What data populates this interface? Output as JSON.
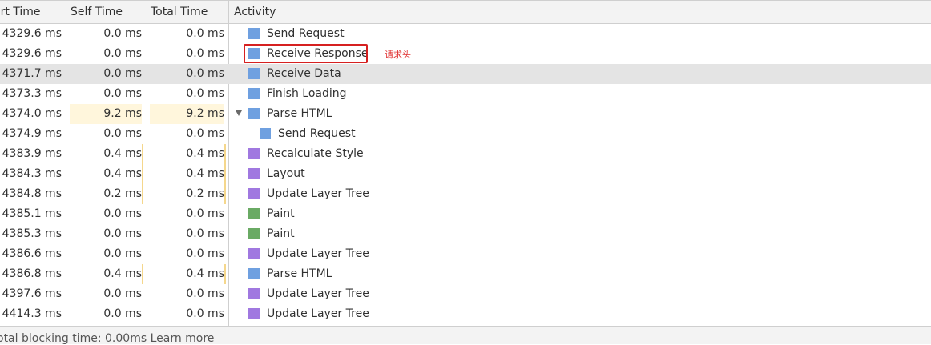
{
  "header": {
    "start_time": "art Time",
    "self_time": "Self Time",
    "total_time": "Total Time",
    "activity": "Activity"
  },
  "colors": {
    "network": "#6fa0e0",
    "rendering": "#a078e0",
    "painting": "#6aaa64",
    "annotation": "#d62020"
  },
  "rows": [
    {
      "start": "4329.6 ms",
      "self": "0.0 ms",
      "total": "0.0 ms",
      "activity": "Send Request",
      "category": "network"
    },
    {
      "start": "4329.6 ms",
      "self": "0.0 ms",
      "total": "0.0 ms",
      "activity": "Receive Response",
      "category": "network"
    },
    {
      "start": "4371.7 ms",
      "self": "0.0 ms",
      "total": "0.0 ms",
      "activity": "Receive Data",
      "category": "network"
    },
    {
      "start": "4373.3 ms",
      "self": "0.0 ms",
      "total": "0.0 ms",
      "activity": "Finish Loading",
      "category": "network"
    },
    {
      "start": "4374.0 ms",
      "self": "9.2 ms",
      "total": "9.2 ms",
      "activity": "Parse HTML",
      "category": "network"
    },
    {
      "start": "4374.9 ms",
      "self": "0.0 ms",
      "total": "0.0 ms",
      "activity": "Send Request",
      "category": "network"
    },
    {
      "start": "4383.9 ms",
      "self": "0.4 ms",
      "total": "0.4 ms",
      "activity": "Recalculate Style",
      "category": "rendering"
    },
    {
      "start": "4384.3 ms",
      "self": "0.4 ms",
      "total": "0.4 ms",
      "activity": "Layout",
      "category": "rendering"
    },
    {
      "start": "4384.8 ms",
      "self": "0.2 ms",
      "total": "0.2 ms",
      "activity": "Update Layer Tree",
      "category": "rendering"
    },
    {
      "start": "4385.1 ms",
      "self": "0.0 ms",
      "total": "0.0 ms",
      "activity": "Paint",
      "category": "painting"
    },
    {
      "start": "4385.3 ms",
      "self": "0.0 ms",
      "total": "0.0 ms",
      "activity": "Paint",
      "category": "painting"
    },
    {
      "start": "4386.6 ms",
      "self": "0.0 ms",
      "total": "0.0 ms",
      "activity": "Update Layer Tree",
      "category": "rendering"
    },
    {
      "start": "4386.8 ms",
      "self": "0.4 ms",
      "total": "0.4 ms",
      "activity": "Parse HTML",
      "category": "network"
    },
    {
      "start": "4397.6 ms",
      "self": "0.0 ms",
      "total": "0.0 ms",
      "activity": "Update Layer Tree",
      "category": "rendering"
    },
    {
      "start": "4414.3 ms",
      "self": "0.0 ms",
      "total": "0.0 ms",
      "activity": "Update Layer Tree",
      "category": "rendering"
    }
  ],
  "annotation": {
    "text": "请求头"
  },
  "footer": {
    "text": "otal blocking time: 0.00ms",
    "link": "Learn more"
  }
}
